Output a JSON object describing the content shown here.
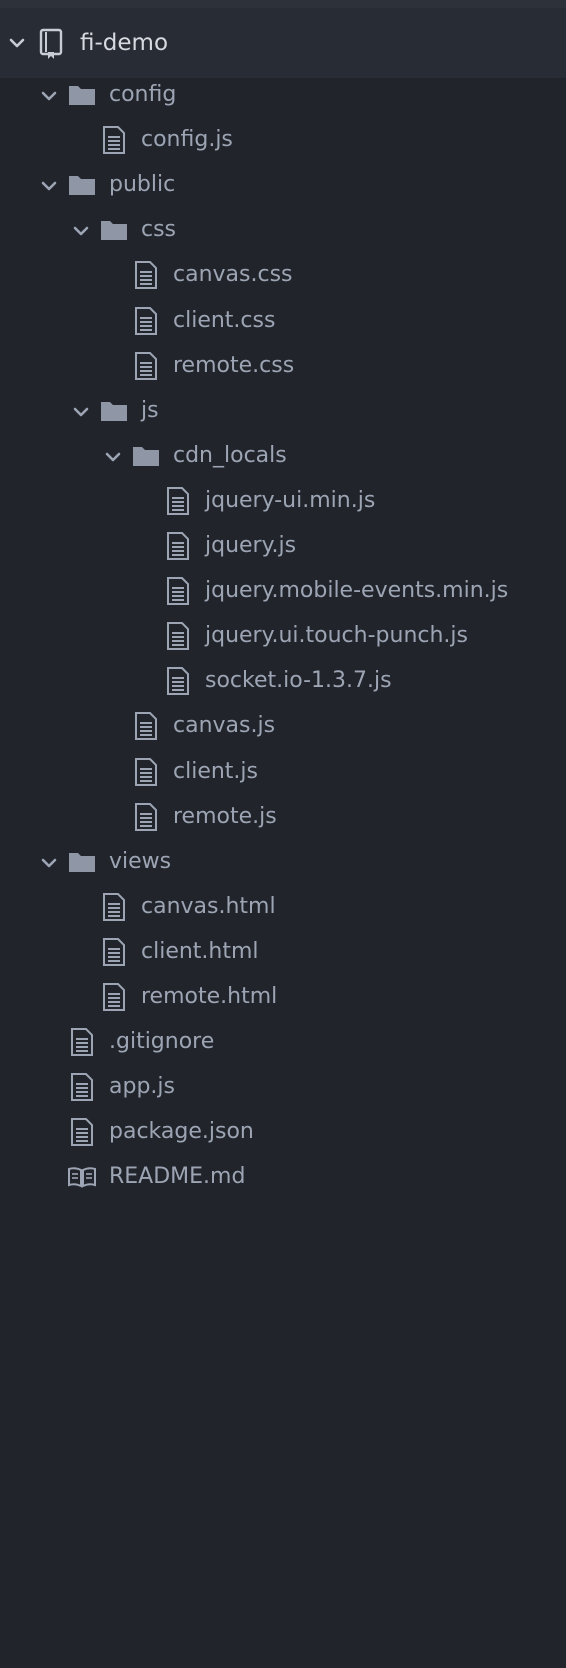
{
  "colors": {
    "background": "#21252b",
    "selected_row": "#282c34",
    "text": "#9da5b4",
    "root_text": "#d7dae0",
    "icon": "#8d94a1",
    "folder_icon": "#8f97a6"
  },
  "root": {
    "label": "fi-demo",
    "icon": "repo-icon",
    "expanded": true
  },
  "tree": [
    {
      "depth": 1,
      "kind": "folder",
      "label": "config",
      "expanded": true,
      "icon": "folder-icon"
    },
    {
      "depth": 2,
      "kind": "file",
      "label": "config.js",
      "icon": "file-text-icon"
    },
    {
      "depth": 1,
      "kind": "folder",
      "label": "public",
      "expanded": true,
      "icon": "folder-icon"
    },
    {
      "depth": 2,
      "kind": "folder",
      "label": "css",
      "expanded": true,
      "icon": "folder-icon"
    },
    {
      "depth": 3,
      "kind": "file",
      "label": "canvas.css",
      "icon": "file-text-icon"
    },
    {
      "depth": 3,
      "kind": "file",
      "label": "client.css",
      "icon": "file-text-icon"
    },
    {
      "depth": 3,
      "kind": "file",
      "label": "remote.css",
      "icon": "file-text-icon"
    },
    {
      "depth": 2,
      "kind": "folder",
      "label": "js",
      "expanded": true,
      "icon": "folder-icon"
    },
    {
      "depth": 3,
      "kind": "folder",
      "label": "cdn_locals",
      "expanded": true,
      "icon": "folder-icon"
    },
    {
      "depth": 4,
      "kind": "file",
      "label": "jquery-ui.min.js",
      "icon": "file-text-icon"
    },
    {
      "depth": 4,
      "kind": "file",
      "label": "jquery.js",
      "icon": "file-text-icon"
    },
    {
      "depth": 4,
      "kind": "file",
      "label": "jquery.mobile-events.min.js",
      "icon": "file-text-icon"
    },
    {
      "depth": 4,
      "kind": "file",
      "label": "jquery.ui.touch-punch.js",
      "icon": "file-text-icon"
    },
    {
      "depth": 4,
      "kind": "file",
      "label": "socket.io-1.3.7.js",
      "icon": "file-text-icon"
    },
    {
      "depth": 3,
      "kind": "file",
      "label": "canvas.js",
      "icon": "file-text-icon"
    },
    {
      "depth": 3,
      "kind": "file",
      "label": "client.js",
      "icon": "file-text-icon"
    },
    {
      "depth": 3,
      "kind": "file",
      "label": "remote.js",
      "icon": "file-text-icon"
    },
    {
      "depth": 1,
      "kind": "folder",
      "label": "views",
      "expanded": true,
      "icon": "folder-icon"
    },
    {
      "depth": 2,
      "kind": "file",
      "label": "canvas.html",
      "icon": "file-text-icon"
    },
    {
      "depth": 2,
      "kind": "file",
      "label": "client.html",
      "icon": "file-text-icon"
    },
    {
      "depth": 2,
      "kind": "file",
      "label": "remote.html",
      "icon": "file-text-icon"
    },
    {
      "depth": 1,
      "kind": "file",
      "label": ".gitignore",
      "icon": "file-text-icon"
    },
    {
      "depth": 1,
      "kind": "file",
      "label": "app.js",
      "icon": "file-text-icon"
    },
    {
      "depth": 1,
      "kind": "file",
      "label": "package.json",
      "icon": "file-text-icon"
    },
    {
      "depth": 1,
      "kind": "file",
      "label": "README.md",
      "icon": "book-icon"
    }
  ]
}
